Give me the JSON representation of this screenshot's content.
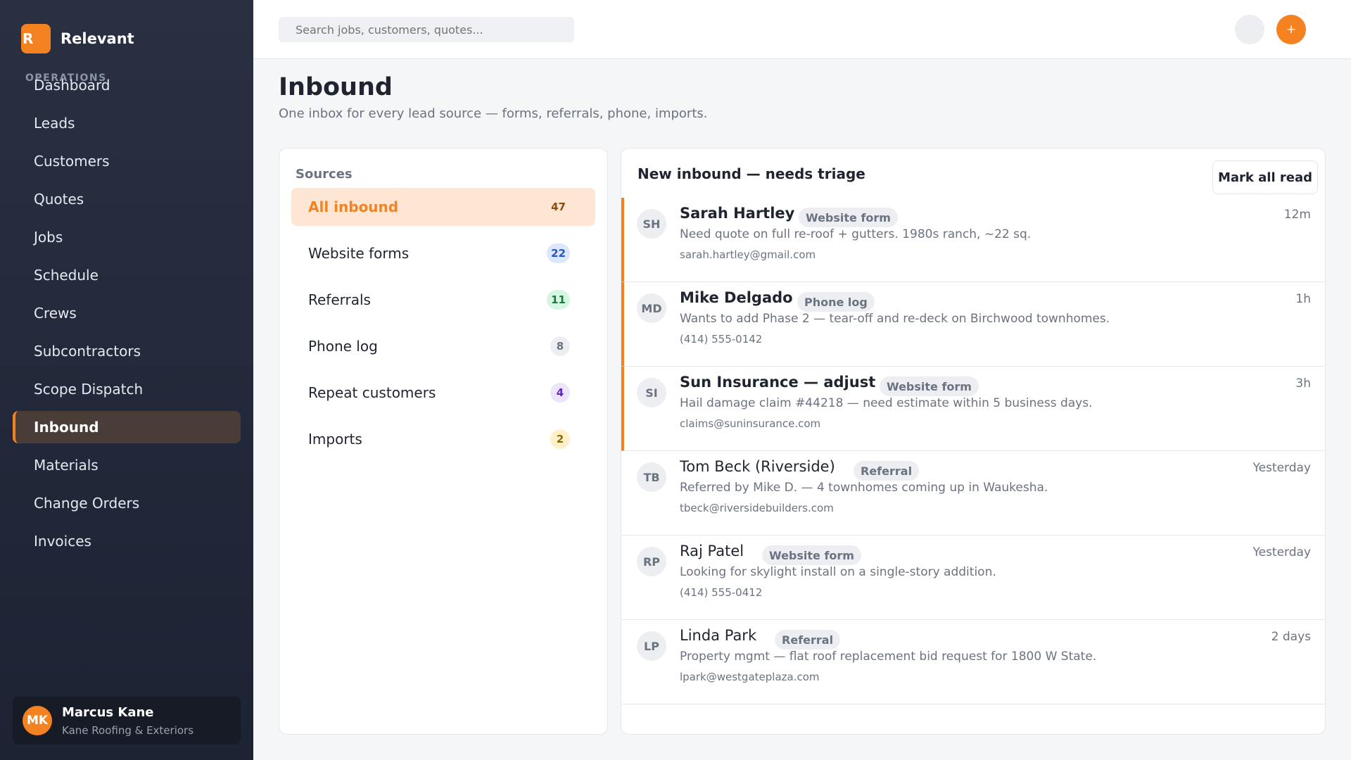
{
  "app": {
    "logo_letter": "R",
    "name": "Relevant"
  },
  "sidebar": {
    "section_label": "OPERATIONS",
    "items": [
      {
        "label": "Dashboard"
      },
      {
        "label": "Leads"
      },
      {
        "label": "Customers"
      },
      {
        "label": "Quotes"
      },
      {
        "label": "Jobs"
      },
      {
        "label": "Schedule"
      },
      {
        "label": "Crews"
      },
      {
        "label": "Subcontractors"
      },
      {
        "label": "Scope Dispatch"
      },
      {
        "label": "Inbound",
        "active": true
      },
      {
        "label": "Materials"
      },
      {
        "label": "Change Orders"
      },
      {
        "label": "Invoices"
      }
    ],
    "user": {
      "initials": "MK",
      "name": "Marcus Kane",
      "company": "Kane Roofing & Exteriors"
    }
  },
  "topbar": {
    "search_placeholder": "Search jobs, customers, quotes...",
    "add_label": "+"
  },
  "page": {
    "title": "Inbound",
    "subtitle": "One inbox for every lead source — forms, referrals, phone, imports."
  },
  "sources": {
    "title": "Sources",
    "items": [
      {
        "label": "All inbound",
        "count": "47",
        "active": true,
        "badge_bg": "transparent",
        "badge_color": "#8a4b12"
      },
      {
        "label": "Website forms",
        "count": "22",
        "badge_bg": "#dbe7fb",
        "badge_color": "#2456c7"
      },
      {
        "label": "Referrals",
        "count": "11",
        "badge_bg": "#d7f5e3",
        "badge_color": "#177a3f"
      },
      {
        "label": "Phone log",
        "count": "8",
        "badge_bg": "#eceef1",
        "badge_color": "#6b7280"
      },
      {
        "label": "Repeat customers",
        "count": "4",
        "badge_bg": "#ece4fb",
        "badge_color": "#5b2bb8"
      },
      {
        "label": "Imports",
        "count": "2",
        "badge_bg": "#fdf0c8",
        "badge_color": "#8a6a10"
      }
    ]
  },
  "inbox": {
    "title": "New inbound — needs triage",
    "mark_all_read": "Mark all read",
    "rows": [
      {
        "initials": "SH",
        "name": "Sarah Hartley",
        "tag": "Website form",
        "time": "12m",
        "message": "Need quote on full re-roof + gutters. 1980s ranch, ~22 sq.",
        "contact": "sarah.hartley@gmail.com",
        "unread": true
      },
      {
        "initials": "MD",
        "name": "Mike Delgado",
        "tag": "Phone log",
        "time": "1h",
        "message": "Wants to add Phase 2 — tear-off and re-deck on Birchwood townhomes.",
        "contact": "(414) 555-0142",
        "unread": true
      },
      {
        "initials": "SI",
        "name": "Sun Insurance — adjuster",
        "tag": "Website form",
        "time": "3h",
        "message": "Hail damage claim #44218 — need estimate within 5 business days.",
        "contact": "claims@suninsurance.com",
        "unread": true
      },
      {
        "initials": "TB",
        "name": "Tom Beck (Riverside)",
        "tag": "Referral",
        "time": "Yesterday",
        "message": "Referred by Mike D. — 4 townhomes coming up in Waukesha.",
        "contact": "tbeck@riversidebuilders.com",
        "unread": false
      },
      {
        "initials": "RP",
        "name": "Raj Patel",
        "tag": "Website form",
        "time": "Yesterday",
        "message": "Looking for skylight install on a single-story addition.",
        "contact": "(414) 555-0412",
        "unread": false
      },
      {
        "initials": "LP",
        "name": "Linda Park",
        "tag": "Referral",
        "time": "2 days",
        "message": "Property mgmt — flat roof replacement bid request for 1800 W State.",
        "contact": "lpark@westgateplaza.com",
        "unread": false
      }
    ]
  }
}
